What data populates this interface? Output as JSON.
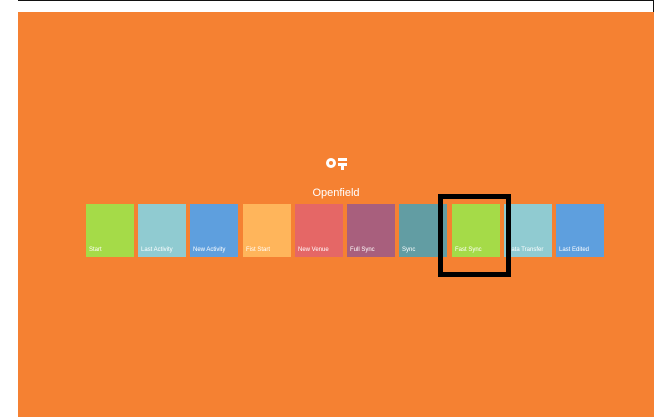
{
  "app": {
    "logo_text": "OF",
    "title": "Openfield"
  },
  "tiles": [
    {
      "label": "Start",
      "color": "#a5db48"
    },
    {
      "label": "Last Activity",
      "color": "#90cbd1"
    },
    {
      "label": "New Activity",
      "color": "#5e9fde"
    },
    {
      "label": "Fist Start",
      "color": "#ffb55b"
    },
    {
      "label": "New Venue",
      "color": "#e56766"
    },
    {
      "label": "Full Sync",
      "color": "#a85f7d"
    },
    {
      "label": "Sync",
      "color": "#629da3"
    },
    {
      "label": "Fast Sync",
      "color": "#a5db48"
    },
    {
      "label": "Data Transfer",
      "color": "#90cbd1"
    },
    {
      "label": "Last Edited",
      "color": "#5e9fde"
    }
  ],
  "selected_tile": "Fast Sync",
  "colors": {
    "background": "#f58132",
    "selection_border": "#000000"
  }
}
